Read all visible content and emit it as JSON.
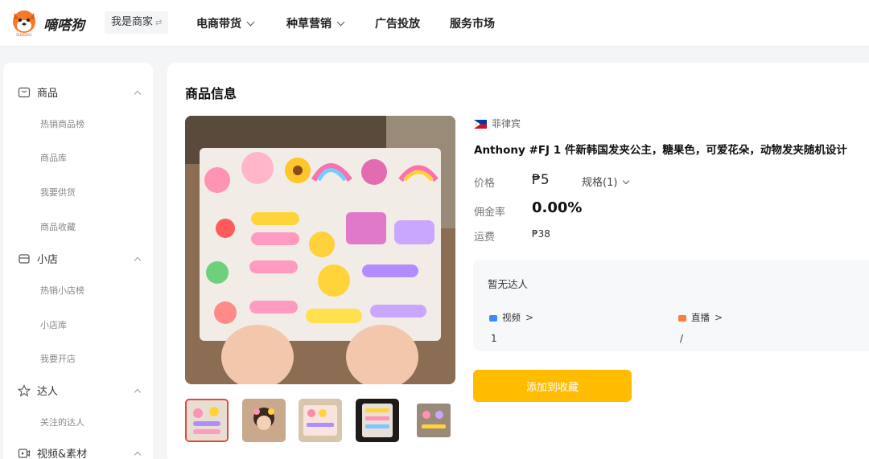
{
  "header": {
    "brand": "嘀嗒狗",
    "merchant": "我是商家",
    "merchant_arrow": "⇄",
    "nav": [
      {
        "label": "电商带货",
        "dropdown": true
      },
      {
        "label": "种草营销",
        "dropdown": true
      },
      {
        "label": "广告投放",
        "dropdown": false
      },
      {
        "label": "服务市场",
        "dropdown": false
      }
    ]
  },
  "sidebar": {
    "sections": [
      {
        "label": "商品",
        "icon": "box-icon",
        "items": [
          "热销商品榜",
          "商品库",
          "我要供货",
          "商品收藏"
        ]
      },
      {
        "label": "小店",
        "icon": "store-icon",
        "items": [
          "热销小店榜",
          "小店库",
          "我要开店"
        ]
      },
      {
        "label": "达人",
        "icon": "star-icon",
        "items": [
          "关注的达人"
        ]
      },
      {
        "label": "视频&素材",
        "icon": "video-icon",
        "items": []
      }
    ]
  },
  "product": {
    "section_title": "商品信息",
    "country": "菲律宾",
    "name": "Anthony #FJ 1 件新韩国发夹公主，糖果色，可爱花朵，动物发夹随机设计",
    "price_label": "价格",
    "price": "₱5",
    "spec": "规格(1)",
    "commission_label": "佣金率",
    "commission": "0.00%",
    "shipping_label": "运费",
    "shipping": "₱38",
    "creator_box": {
      "empty_text": "暂无达人",
      "stats": [
        {
          "label": "视频",
          "value": "1",
          "color": "#3d8bff"
        },
        {
          "label": "直播",
          "value": "/",
          "color": "#ff7a3d"
        }
      ]
    },
    "add_button": "添加到收藏"
  },
  "colors": {
    "accent": "#ffbc00",
    "thumb_active": "#e14a3a"
  }
}
